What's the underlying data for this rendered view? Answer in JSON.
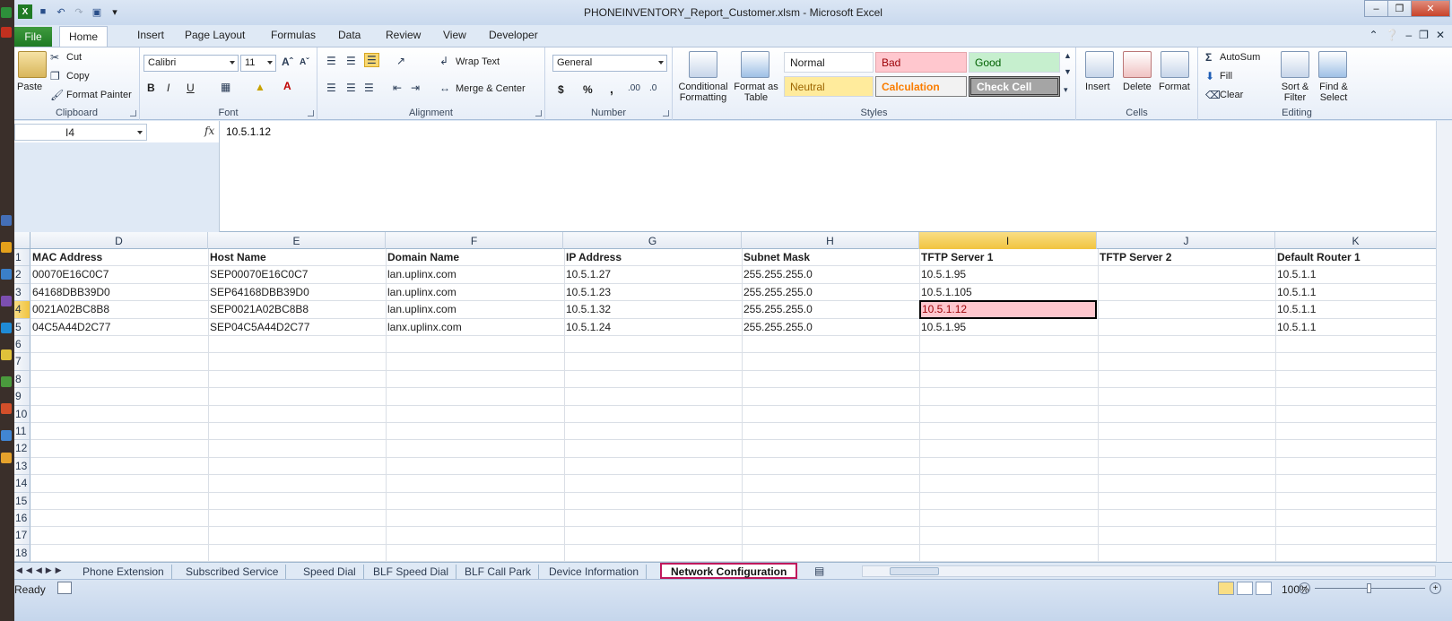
{
  "window": {
    "title": "PHONEINVENTORY_Report_Customer.xlsm - Microsoft Excel"
  },
  "ribbon_tabs": [
    "File",
    "Home",
    "Insert",
    "Page Layout",
    "Formulas",
    "Data",
    "Review",
    "View",
    "Developer"
  ],
  "active_tab": "Home",
  "ribbon": {
    "clipboard": {
      "label": "Clipboard",
      "paste": "Paste",
      "cut": "Cut",
      "copy": "Copy",
      "format_painter": "Format Painter"
    },
    "font": {
      "label": "Font",
      "font_name": "Calibri",
      "font_size": "11",
      "bold": "B",
      "italic": "I",
      "underline": "U"
    },
    "alignment": {
      "label": "Alignment",
      "wrap_text": "Wrap Text",
      "merge_center": "Merge & Center"
    },
    "number": {
      "label": "Number",
      "format": "General",
      "currency": "$",
      "percent": "%",
      "comma": ","
    },
    "styles": {
      "label": "Styles",
      "conditional_formatting": "Conditional Formatting",
      "format_as_table": "Format as Table",
      "normal": "Normal",
      "bad": "Bad",
      "good": "Good",
      "neutral": "Neutral",
      "calculation": "Calculation",
      "check_cell": "Check Cell"
    },
    "cells": {
      "label": "Cells",
      "insert": "Insert",
      "delete": "Delete",
      "format": "Format"
    },
    "editing": {
      "label": "Editing",
      "autosum": "AutoSum",
      "fill": "Fill",
      "clear": "Clear",
      "sort_filter": "Sort & Filter",
      "find_select": "Find & Select"
    }
  },
  "formula_bar": {
    "name_box": "I4",
    "fx": "fx",
    "value": "10.5.1.12"
  },
  "sheet": {
    "columns": [
      "D",
      "E",
      "F",
      "G",
      "H",
      "I",
      "J",
      "K"
    ],
    "selected_column": "I",
    "rows": [
      "1",
      "2",
      "3",
      "4",
      "5",
      "6",
      "7",
      "8",
      "9",
      "10",
      "11",
      "12",
      "13",
      "14",
      "15",
      "16",
      "17",
      "18"
    ],
    "selected_row": "4",
    "headers": [
      "MAC Address",
      "Host Name",
      "Domain Name",
      "IP Address",
      "Subnet Mask",
      "TFTP Server 1",
      "TFTP Server 2",
      "Default Router 1"
    ],
    "data": [
      [
        "00070E16C0C7",
        "SEP00070E16C0C7",
        "lan.uplinx.com",
        "10.5.1.27",
        "255.255.255.0",
        "10.5.1.95",
        "",
        "10.5.1.1"
      ],
      [
        "64168DBB39D0",
        "SEP64168DBB39D0",
        "lan.uplinx.com",
        "10.5.1.23",
        "255.255.255.0",
        "10.5.1.105",
        "",
        "10.5.1.1"
      ],
      [
        "0021A02BC8B8",
        "SEP0021A02BC8B8",
        "lan.uplinx.com",
        "10.5.1.32",
        "255.255.255.0",
        "10.5.1.12",
        "",
        "10.5.1.1"
      ],
      [
        "04C5A44D2C77",
        "SEP04C5A44D2C77",
        "lanx.uplinx.com",
        "10.5.1.24",
        "255.255.255.0",
        "10.5.1.95",
        "",
        "10.5.1.1"
      ]
    ]
  },
  "sheet_tabs": [
    "Phone Extension",
    "Subscribed Service",
    "Speed Dial",
    "BLF Speed Dial",
    "BLF Call Park",
    "Device Information",
    "Network Configuration"
  ],
  "active_sheet": "Network Configuration",
  "status": {
    "ready": "Ready",
    "zoom": "100%"
  },
  "colors": {
    "active_tab_border": "#c0185c",
    "bad_fill": "#ffc7ce",
    "bad_text": "#9c0006",
    "selection_header": "#f1c43f"
  }
}
